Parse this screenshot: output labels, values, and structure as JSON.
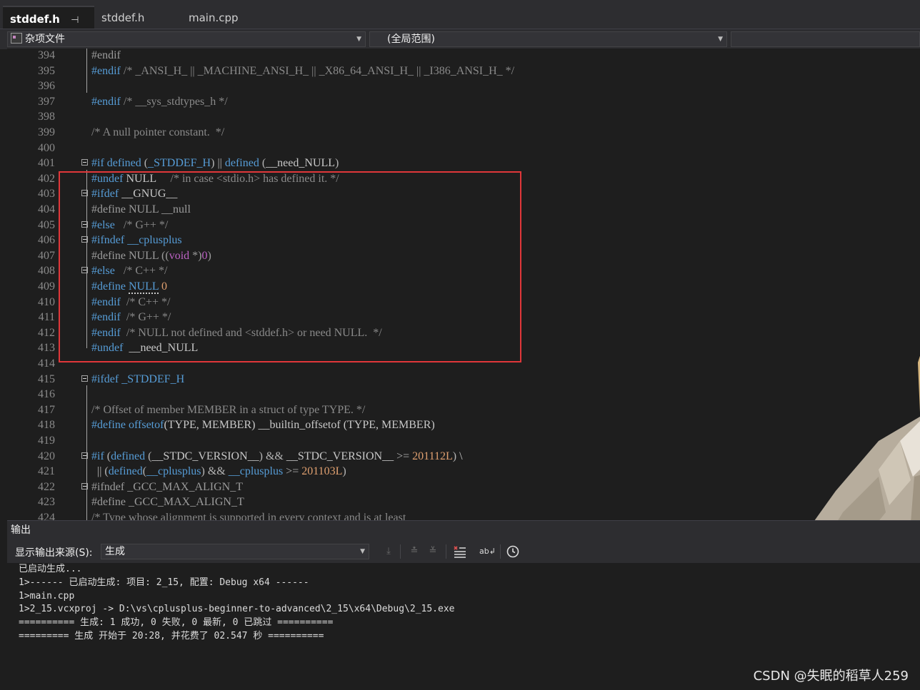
{
  "tabs": [
    {
      "label": "stddef.h",
      "active": true,
      "pin": "⊣",
      "close": "✕"
    },
    {
      "label": "stddef.h",
      "active": false
    },
    {
      "label": "main.cpp",
      "active": false
    }
  ],
  "navigation": {
    "project_scope": "杂项文件",
    "member_scope": "(全局范围)",
    "third_scope": ""
  },
  "editor": {
    "lines": [
      {
        "n": "394",
        "tokens": [
          [
            "pp",
            "#endif"
          ]
        ]
      },
      {
        "n": "395",
        "tokens": [
          [
            "ppa",
            "#endif"
          ],
          [
            "cmt",
            " /* _ANSI_H_ || _MACHINE_ANSI_H_ || _X86_64_ANSI_H_ || _I386_ANSI_H_ */"
          ]
        ]
      },
      {
        "n": "396",
        "tokens": []
      },
      {
        "n": "397",
        "tokens": [
          [
            "ppa",
            "#endif"
          ],
          [
            "cmt",
            " /* __sys_stdtypes_h */"
          ]
        ]
      },
      {
        "n": "398",
        "tokens": []
      },
      {
        "n": "399",
        "tokens": [
          [
            "cmt",
            "/* A null pointer constant.  */"
          ]
        ]
      },
      {
        "n": "400",
        "tokens": []
      },
      {
        "n": "401",
        "tokens": [
          [
            "ppa",
            "#if"
          ],
          [
            "ppa",
            " defined"
          ],
          [
            "op",
            " ("
          ],
          [
            "ppa",
            "_STDDEF_H"
          ],
          [
            "op",
            ")"
          ],
          [
            "op",
            " || "
          ],
          [
            "ppa",
            "defined"
          ],
          [
            "op",
            " ("
          ],
          [
            "id",
            "__need_NULL"
          ],
          [
            "op",
            ")"
          ]
        ]
      },
      {
        "n": "402",
        "tokens": [
          [
            "ppa",
            "#undef"
          ],
          [
            "id",
            " NULL"
          ],
          [
            "cmt",
            "     /* in case <stdio.h> has defined it. */"
          ]
        ]
      },
      {
        "n": "403",
        "tokens": [
          [
            "ppa",
            "#ifdef"
          ],
          [
            "id",
            " __GNUG__"
          ]
        ]
      },
      {
        "n": "404",
        "tokens": [
          [
            "pp",
            "#define"
          ],
          [
            "pp",
            " NULL __null"
          ]
        ]
      },
      {
        "n": "405",
        "tokens": [
          [
            "ppa",
            "#else"
          ],
          [
            "cmt",
            "   /* G++ */"
          ]
        ]
      },
      {
        "n": "406",
        "tokens": [
          [
            "ppa",
            "#ifndef"
          ],
          [
            "ppa",
            " __cplusplus"
          ]
        ]
      },
      {
        "n": "407",
        "tokens": [
          [
            "pp",
            "#define"
          ],
          [
            "pp",
            " NULL (("
          ],
          [
            "mac",
            "void"
          ],
          [
            "pp",
            " *)"
          ],
          [
            "mac",
            "0"
          ],
          [
            "pp",
            ")"
          ]
        ]
      },
      {
        "n": "408",
        "tokens": [
          [
            "ppa",
            "#else"
          ],
          [
            "cmt",
            "   /* C++ */"
          ]
        ]
      },
      {
        "n": "409",
        "tokens": [
          [
            "ppa",
            "#define"
          ],
          [
            "id",
            " "
          ],
          [
            "ppa",
            "NULL"
          ],
          [
            "num",
            " 0"
          ]
        ]
      },
      {
        "n": "410",
        "tokens": [
          [
            "ppa",
            "#endif"
          ],
          [
            "cmt",
            "  /* C++ */"
          ]
        ]
      },
      {
        "n": "411",
        "tokens": [
          [
            "ppa",
            "#endif"
          ],
          [
            "cmt",
            "  /* G++ */"
          ]
        ]
      },
      {
        "n": "412",
        "tokens": [
          [
            "ppa",
            "#endif"
          ],
          [
            "cmt",
            "  /* NULL not defined and <stddef.h> or need NULL.  */"
          ]
        ]
      },
      {
        "n": "413",
        "tokens": [
          [
            "ppa",
            "#undef"
          ],
          [
            "id",
            "  __need_NULL"
          ]
        ]
      },
      {
        "n": "414",
        "tokens": []
      },
      {
        "n": "415",
        "tokens": [
          [
            "ppa",
            "#ifdef"
          ],
          [
            "ppa",
            " _STDDEF_H"
          ]
        ]
      },
      {
        "n": "416",
        "tokens": []
      },
      {
        "n": "417",
        "tokens": [
          [
            "cmt",
            "/* Offset of member MEMBER in a struct of type TYPE. */"
          ]
        ]
      },
      {
        "n": "418",
        "tokens": [
          [
            "ppa",
            "#define"
          ],
          [
            "ppa",
            " offsetof"
          ],
          [
            "id",
            "(TYPE, MEMBER) __builtin_offsetof (TYPE, MEMBER)"
          ]
        ]
      },
      {
        "n": "419",
        "tokens": []
      },
      {
        "n": "420",
        "tokens": [
          [
            "ppa",
            "#if"
          ],
          [
            "op",
            " ("
          ],
          [
            "ppa",
            "defined"
          ],
          [
            "op",
            " ("
          ],
          [
            "id",
            "__STDC_VERSION__"
          ],
          [
            "op",
            ")"
          ],
          [
            "op",
            " && "
          ],
          [
            "id",
            "__STDC_VERSION__"
          ],
          [
            "op",
            " >= "
          ],
          [
            "num",
            "201112L"
          ],
          [
            "op",
            ")"
          ],
          [
            "id",
            " \\"
          ]
        ]
      },
      {
        "n": "421",
        "tokens": [
          [
            "op",
            "  || ("
          ],
          [
            "ppa",
            "defined"
          ],
          [
            "op",
            "("
          ],
          [
            "ppa",
            "__cplusplus"
          ],
          [
            "op",
            ")"
          ],
          [
            "op",
            " && "
          ],
          [
            "ppa",
            "__cplusplus"
          ],
          [
            "op",
            " >= "
          ],
          [
            "num",
            "201103L"
          ],
          [
            "op",
            ")"
          ]
        ]
      },
      {
        "n": "422",
        "tokens": [
          [
            "pp",
            "#ifndef"
          ],
          [
            "pp",
            " _GCC_MAX_ALIGN_T"
          ]
        ]
      },
      {
        "n": "423",
        "tokens": [
          [
            "pp",
            "#define"
          ],
          [
            "pp",
            " _GCC_MAX_ALIGN_T"
          ]
        ]
      },
      {
        "n": "424",
        "tokens": [
          [
            "cmt",
            "/* Type whose alignment is supported in every context and is at least"
          ]
        ]
      }
    ]
  },
  "output_panel": {
    "title": "输出",
    "source_label": "显示输出来源(S):",
    "source_value": "生成",
    "lines": [
      "已启动生成...",
      "1>------ 已启动生成: 项目: 2_15, 配置: Debug x64 ------",
      "1>main.cpp",
      "1>2_15.vcxproj -> D:\\vs\\cplusplus-beginner-to-advanced\\2_15\\x64\\Debug\\2_15.exe",
      "========== 生成: 1 成功, 0 失败, 0 最新, 0 已跳过 ==========",
      "========= 生成 开始于 20:28, 并花费了 02.547 秒 =========="
    ]
  },
  "watermark": "CSDN @失眠的稻草人259",
  "colors": {
    "highlight_box": "#e0373a",
    "keyword": "#569cd6",
    "comment": "#8a8a8a",
    "number": "#e0a070"
  }
}
